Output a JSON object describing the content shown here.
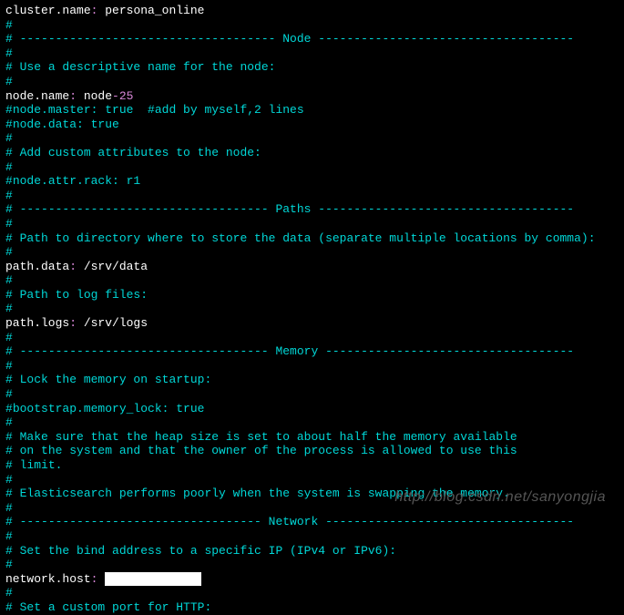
{
  "config": {
    "cluster_name_key": "cluster.name",
    "cluster_name_value": "persona_online",
    "node_section_header": " ------------------------------------ Node ------------------------------------",
    "node_desc_comment": " Use a descriptive name for the node:",
    "node_name_key": "node.name",
    "node_name_prefix": "node",
    "node_name_num": "25",
    "node_master_comment": "node.master: true  #add by myself,2 lines",
    "node_data_comment": "node.data: true",
    "node_attr_comment": " Add custom attributes to the node:",
    "node_rack_comment": "node.attr.rack: r1",
    "paths_section_header": " ----------------------------------- Paths ------------------------------------",
    "path_data_comment": " Path to directory where to store the data (separate multiple locations by comma):",
    "path_data_key": "path.data",
    "path_data_value": "/srv/data",
    "path_logs_comment": " Path to log files:",
    "path_logs_key": "path.logs",
    "path_logs_value": "/srv/logs",
    "memory_section_header": " ----------------------------------- Memory -----------------------------------",
    "memory_lock_comment": " Lock the memory on startup:",
    "bootstrap_comment": "bootstrap.memory_lock: true",
    "heap_comment1": " Make sure that the heap size is set to about half the memory available",
    "heap_comment2": " on the system and that the owner of the process is allowed to use this",
    "heap_comment3": " limit.",
    "swap_comment": " Elasticsearch performs poorly when the system is swapping the memory.",
    "network_section_header": " ---------------------------------- Network -----------------------------------",
    "bind_comment": " Set the bind address to a specific IP (IPv4 or IPv6):",
    "network_host_key": "network.host",
    "network_host_redacted": "xxxxxxxxxxxxx",
    "http_comment": " Set a custom port for HTTP:",
    "hash": "#",
    "colon_space": ": ",
    "watermark": "http://blog.csdn.net/sanyongjia"
  }
}
